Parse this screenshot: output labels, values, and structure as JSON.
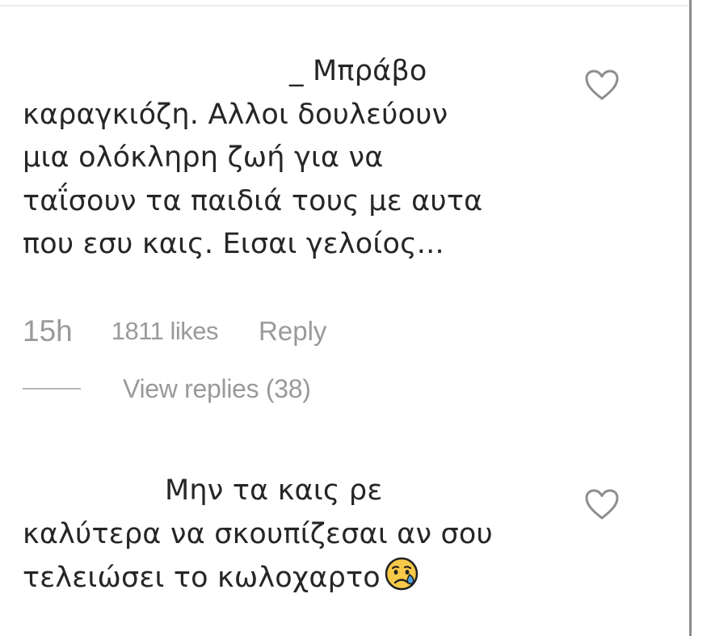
{
  "comments": [
    {
      "line1": "_ Μπράβο",
      "line2": "καραγκιόζη. Αλλοι δουλεύουν",
      "line3": "μια ολόκληρη ζωή για να",
      "line4": "ταΐσουν τα παιδιά τους με αυτα",
      "line5": "που εσυ καις. Εισαι γελοίος...",
      "time": "15h",
      "likes": "1811 likes",
      "reply_label": "Reply",
      "view_replies": "View replies (38)",
      "like_icon": "heart-outline-icon"
    },
    {
      "line1": "Μην τα καις ρε",
      "line2": "καλύτερα να σκουπίζεσαι αν σου",
      "line3": "τελειώσει το κωλοχαρτο",
      "emoji": "crying-face-emoji",
      "like_icon": "heart-outline-icon"
    }
  ],
  "colors": {
    "text": "#262626",
    "meta": "#9a9a9a",
    "heart": "#8e8e8e",
    "emoji_face": "#f7c948",
    "emoji_tear": "#4aa3df"
  }
}
